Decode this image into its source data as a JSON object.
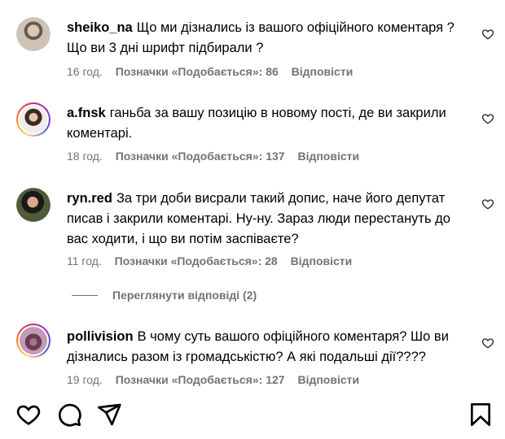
{
  "comments": [
    {
      "username": "sheiko_na",
      "text": "Що ми дізнались із вашого офіційного коментаря ? Що ви 3 дні шрифт підбирали ?",
      "time": "16 год.",
      "likes": "Позначки «Подобається»: 86",
      "reply": "Відповісти",
      "avatar_icon": "user-avatar"
    },
    {
      "username": "a.fnsk",
      "text": "ганьба за вашу позицію в новому пості, де ви закрили коментарі.",
      "time": "18 год.",
      "likes": "Позначки «Подобається»: 137",
      "reply": "Відповісти",
      "avatar_icon": "user-avatar-story-ring"
    },
    {
      "username": "ryn.red",
      "text": "За три доби висрали такий допис, наче його депутат писав і закрили коментарі. Ну-ну. Зараз люди перестануть до вас ходити, і що ви потім заспіваєте?",
      "time": "11 год.",
      "likes": "Позначки «Подобається»: 28",
      "reply": "Відповісти",
      "avatar_icon": "user-avatar"
    },
    {
      "username": "pollivision",
      "text": "В чому суть вашого офіційного коментаря? Шо ви дізнались разом із громадськістю? А які подальші дії????",
      "time": "19 год.",
      "likes": "Позначки «Подобається»: 127",
      "reply": "Відповісти",
      "avatar_icon": "user-avatar-story-ring"
    }
  ],
  "view_replies": "Переглянути відповіді (2)",
  "actions": {
    "like_icon": "heart-icon",
    "comment_icon": "comment-icon",
    "share_icon": "paper-plane-icon",
    "save_icon": "bookmark-icon"
  }
}
